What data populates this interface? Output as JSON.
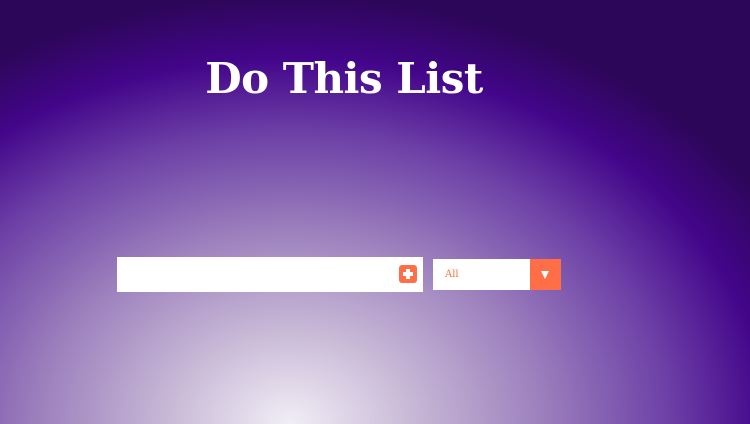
{
  "header": {
    "title": "Do This List"
  },
  "todo_form": {
    "input_value": "",
    "input_placeholder": "",
    "add_button_icon": "plus-square-icon"
  },
  "filter": {
    "selected": "All",
    "toggle_icon": "chevron-down-icon"
  },
  "colors": {
    "accent": "#ff6f47",
    "background_edge": "#43058a",
    "background_center": "#f1eef6"
  }
}
